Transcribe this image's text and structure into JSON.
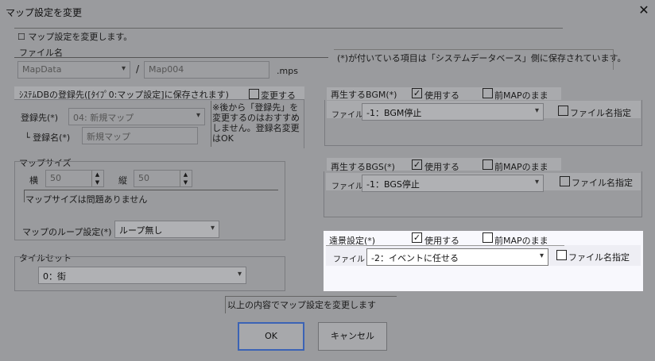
{
  "window": {
    "title": "マップ設定を変更",
    "close_label": "✕"
  },
  "description": "☐ マップ設定を変更します。",
  "filename": {
    "label": "ファイル名",
    "folder": "MapData",
    "separator": "/",
    "name": "Map004",
    "extension": ".mps"
  },
  "note_saved": "(*)が付いている項目は「システムデータベース」側に保存されています。",
  "sysdb": {
    "header": "ｼｽﾃﾑDBの登録先([ﾀｲﾌﾟ0:マップ設定]に保存されます)",
    "change_label": "変更する",
    "target_label": "登録先(*)",
    "target_value": "04: 新規マップ",
    "name_label": "└ 登録名(*)",
    "name_value": "新規マップ",
    "note": "※後から「登録先」を変更するのはおすすめしません。登録名変更はOK"
  },
  "mapsize": {
    "header": "マップサイズ",
    "width_label": "横",
    "width_value": "50",
    "height_label": "縦",
    "height_value": "50",
    "status": "マップサイズは問題ありません",
    "loop_label": "マップのループ設定(*)",
    "loop_value": "ループ無し"
  },
  "tileset": {
    "header": "タイルセット",
    "value": "0：街"
  },
  "bgm": {
    "header": "再生するBGM(*)",
    "use_label": "使用する",
    "use_checked": "✓",
    "keep_label": "前MAPのまま",
    "file_label": "ファイル",
    "file_value": "-1：BGM停止",
    "fname_label": "ファイル名指定"
  },
  "bgs": {
    "header": "再生するBGS(*)",
    "use_label": "使用する",
    "use_checked": "✓",
    "keep_label": "前MAPのまま",
    "file_label": "ファイル",
    "file_value": "-1：BGS停止",
    "fname_label": "ファイル名指定"
  },
  "farview": {
    "header": "遠景設定(*)",
    "use_label": "使用する",
    "use_checked": "✓",
    "keep_label": "前MAPのまま",
    "file_label": "ファイル",
    "file_value": "-2：イベントに任せる",
    "fname_label": "ファイル名指定"
  },
  "footer_note": "以上の内容でマップ設定を変更します",
  "buttons": {
    "ok": "OK",
    "cancel": "キャンセル"
  },
  "icons": {
    "dropdown": "▾",
    "spin_up": "▲",
    "spin_down": "▼"
  },
  "colors": {
    "highlight_panel": "#f8f8fd",
    "ok_border": "#3b63b5"
  }
}
